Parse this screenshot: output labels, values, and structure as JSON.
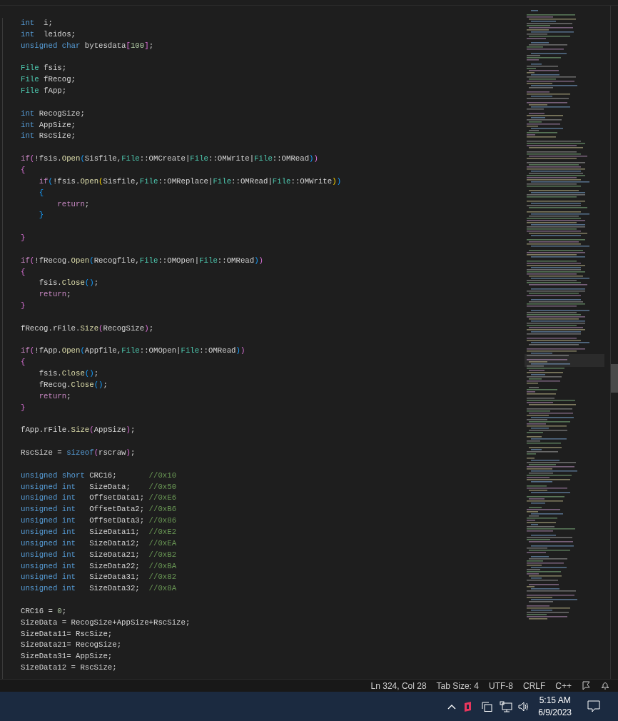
{
  "editor": {
    "lines": [
      {
        "kind": "code",
        "tokens": [
          {
            "kind": "keyword",
            "text": "int"
          },
          {
            "kind": "plain",
            "text": "  i;"
          }
        ]
      },
      {
        "kind": "code",
        "tokens": [
          {
            "kind": "keyword",
            "text": "int"
          },
          {
            "kind": "plain",
            "text": "  leidos;"
          }
        ]
      },
      {
        "kind": "code",
        "tokens": [
          {
            "kind": "keyword",
            "text": "unsigned char"
          },
          {
            "kind": "plain",
            "text": " bytesdata"
          },
          {
            "kind": "bracket2",
            "text": "["
          },
          {
            "kind": "number",
            "text": "100"
          },
          {
            "kind": "bracket2",
            "text": "]"
          },
          {
            "kind": "plain",
            "text": ";"
          }
        ]
      },
      {
        "kind": "blank"
      },
      {
        "kind": "code",
        "tokens": [
          {
            "kind": "type",
            "text": "File"
          },
          {
            "kind": "plain",
            "text": " fsis;"
          }
        ]
      },
      {
        "kind": "code",
        "tokens": [
          {
            "kind": "type",
            "text": "File"
          },
          {
            "kind": "plain",
            "text": " fRecog;"
          }
        ]
      },
      {
        "kind": "code",
        "tokens": [
          {
            "kind": "type",
            "text": "File"
          },
          {
            "kind": "plain",
            "text": " fApp;"
          }
        ]
      },
      {
        "kind": "blank"
      },
      {
        "kind": "code",
        "tokens": [
          {
            "kind": "keyword",
            "text": "int"
          },
          {
            "kind": "plain",
            "text": " RecogSize;"
          }
        ]
      },
      {
        "kind": "code",
        "tokens": [
          {
            "kind": "keyword",
            "text": "int"
          },
          {
            "kind": "plain",
            "text": " AppSize;"
          }
        ]
      },
      {
        "kind": "code",
        "tokens": [
          {
            "kind": "keyword",
            "text": "int"
          },
          {
            "kind": "plain",
            "text": " RscSize;"
          }
        ]
      },
      {
        "kind": "blank"
      },
      {
        "kind": "code",
        "tokens": [
          {
            "kind": "control",
            "text": "if"
          },
          {
            "kind": "bracket2",
            "text": "("
          },
          {
            "kind": "plain",
            "text": "!fsis."
          },
          {
            "kind": "function",
            "text": "Open"
          },
          {
            "kind": "bracket3",
            "text": "("
          },
          {
            "kind": "plain",
            "text": "Sisfile,"
          },
          {
            "kind": "type",
            "text": "File"
          },
          {
            "kind": "plain",
            "text": "::OMCreate|"
          },
          {
            "kind": "type",
            "text": "File"
          },
          {
            "kind": "plain",
            "text": "::OMWrite|"
          },
          {
            "kind": "type",
            "text": "File"
          },
          {
            "kind": "plain",
            "text": "::OMRead"
          },
          {
            "kind": "bracket3",
            "text": ")"
          },
          {
            "kind": "bracket2",
            "text": ")"
          }
        ]
      },
      {
        "kind": "code",
        "tokens": [
          {
            "kind": "bracket2",
            "text": "{"
          }
        ]
      },
      {
        "kind": "code",
        "tokens": [
          {
            "kind": "indent"
          },
          {
            "kind": "control",
            "text": "if"
          },
          {
            "kind": "bracket3",
            "text": "("
          },
          {
            "kind": "plain",
            "text": "!fsis."
          },
          {
            "kind": "function",
            "text": "Open"
          },
          {
            "kind": "bracket1",
            "text": "("
          },
          {
            "kind": "plain",
            "text": "Sisfile,"
          },
          {
            "kind": "type",
            "text": "File"
          },
          {
            "kind": "plain",
            "text": "::OMReplace|"
          },
          {
            "kind": "type",
            "text": "File"
          },
          {
            "kind": "plain",
            "text": "::OMRead|"
          },
          {
            "kind": "type",
            "text": "File"
          },
          {
            "kind": "plain",
            "text": "::OMWrite"
          },
          {
            "kind": "bracket1",
            "text": ")"
          },
          {
            "kind": "bracket3",
            "text": ")"
          }
        ]
      },
      {
        "kind": "code",
        "tokens": [
          {
            "kind": "indent"
          },
          {
            "kind": "bracket3",
            "text": "{"
          }
        ]
      },
      {
        "kind": "code",
        "tokens": [
          {
            "kind": "indent"
          },
          {
            "kind": "indent"
          },
          {
            "kind": "control",
            "text": "return"
          },
          {
            "kind": "plain",
            "text": ";"
          }
        ]
      },
      {
        "kind": "code",
        "tokens": [
          {
            "kind": "indent"
          },
          {
            "kind": "bracket3",
            "text": "}"
          }
        ]
      },
      {
        "kind": "blank"
      },
      {
        "kind": "code",
        "tokens": [
          {
            "kind": "bracket2",
            "text": "}"
          }
        ]
      },
      {
        "kind": "blank"
      },
      {
        "kind": "code",
        "tokens": [
          {
            "kind": "control",
            "text": "if"
          },
          {
            "kind": "bracket2",
            "text": "("
          },
          {
            "kind": "plain",
            "text": "!fRecog."
          },
          {
            "kind": "function",
            "text": "Open"
          },
          {
            "kind": "bracket3",
            "text": "("
          },
          {
            "kind": "plain",
            "text": "Recogfile,"
          },
          {
            "kind": "type",
            "text": "File"
          },
          {
            "kind": "plain",
            "text": "::OMOpen|"
          },
          {
            "kind": "type",
            "text": "File"
          },
          {
            "kind": "plain",
            "text": "::OMRead"
          },
          {
            "kind": "bracket3",
            "text": ")"
          },
          {
            "kind": "bracket2",
            "text": ")"
          }
        ]
      },
      {
        "kind": "code",
        "tokens": [
          {
            "kind": "bracket2",
            "text": "{"
          }
        ]
      },
      {
        "kind": "code",
        "tokens": [
          {
            "kind": "indent"
          },
          {
            "kind": "plain",
            "text": "fsis."
          },
          {
            "kind": "function",
            "text": "Close"
          },
          {
            "kind": "bracket3",
            "text": "()"
          },
          {
            "kind": "plain",
            "text": ";"
          }
        ]
      },
      {
        "kind": "code",
        "tokens": [
          {
            "kind": "indent"
          },
          {
            "kind": "control",
            "text": "return"
          },
          {
            "kind": "plain",
            "text": ";"
          }
        ]
      },
      {
        "kind": "code",
        "tokens": [
          {
            "kind": "bracket2",
            "text": "}"
          }
        ]
      },
      {
        "kind": "blank"
      },
      {
        "kind": "code",
        "tokens": [
          {
            "kind": "plain",
            "text": "fRecog.rFile."
          },
          {
            "kind": "function",
            "text": "Size"
          },
          {
            "kind": "bracket2",
            "text": "("
          },
          {
            "kind": "plain",
            "text": "RecogSize"
          },
          {
            "kind": "bracket2",
            "text": ")"
          },
          {
            "kind": "plain",
            "text": ";"
          }
        ]
      },
      {
        "kind": "blank"
      },
      {
        "kind": "code",
        "tokens": [
          {
            "kind": "control",
            "text": "if"
          },
          {
            "kind": "bracket2",
            "text": "("
          },
          {
            "kind": "plain",
            "text": "!fApp."
          },
          {
            "kind": "function",
            "text": "Open"
          },
          {
            "kind": "bracket3",
            "text": "("
          },
          {
            "kind": "plain",
            "text": "Appfile,"
          },
          {
            "kind": "type",
            "text": "File"
          },
          {
            "kind": "plain",
            "text": "::OMOpen|"
          },
          {
            "kind": "type",
            "text": "File"
          },
          {
            "kind": "plain",
            "text": "::OMRead"
          },
          {
            "kind": "bracket3",
            "text": ")"
          },
          {
            "kind": "bracket2",
            "text": ")"
          }
        ]
      },
      {
        "kind": "code",
        "tokens": [
          {
            "kind": "bracket2",
            "text": "{"
          }
        ]
      },
      {
        "kind": "code",
        "tokens": [
          {
            "kind": "indent"
          },
          {
            "kind": "plain",
            "text": "fsis."
          },
          {
            "kind": "function",
            "text": "Close"
          },
          {
            "kind": "bracket3",
            "text": "()"
          },
          {
            "kind": "plain",
            "text": ";"
          }
        ]
      },
      {
        "kind": "code",
        "tokens": [
          {
            "kind": "indent"
          },
          {
            "kind": "plain",
            "text": "fRecog."
          },
          {
            "kind": "function",
            "text": "Close"
          },
          {
            "kind": "bracket3",
            "text": "()"
          },
          {
            "kind": "plain",
            "text": ";"
          }
        ]
      },
      {
        "kind": "code",
        "tokens": [
          {
            "kind": "indent"
          },
          {
            "kind": "control",
            "text": "return"
          },
          {
            "kind": "plain",
            "text": ";"
          }
        ]
      },
      {
        "kind": "code",
        "tokens": [
          {
            "kind": "bracket2",
            "text": "}"
          }
        ]
      },
      {
        "kind": "blank"
      },
      {
        "kind": "code",
        "tokens": [
          {
            "kind": "plain",
            "text": "fApp.rFile."
          },
          {
            "kind": "function",
            "text": "Size"
          },
          {
            "kind": "bracket2",
            "text": "("
          },
          {
            "kind": "plain",
            "text": "AppSize"
          },
          {
            "kind": "bracket2",
            "text": ")"
          },
          {
            "kind": "plain",
            "text": ";"
          }
        ]
      },
      {
        "kind": "blank"
      },
      {
        "kind": "code",
        "tokens": [
          {
            "kind": "plain",
            "text": "RscSize = "
          },
          {
            "kind": "keyword",
            "text": "sizeof"
          },
          {
            "kind": "bracket2",
            "text": "("
          },
          {
            "kind": "plain",
            "text": "rscraw"
          },
          {
            "kind": "bracket2",
            "text": ")"
          },
          {
            "kind": "plain",
            "text": ";"
          }
        ]
      },
      {
        "kind": "blank"
      },
      {
        "kind": "code",
        "tokens": [
          {
            "kind": "keyword",
            "text": "unsigned short"
          },
          {
            "kind": "plain",
            "text": " CRC16;       "
          },
          {
            "kind": "comment",
            "text": "//0x10"
          }
        ]
      },
      {
        "kind": "code",
        "tokens": [
          {
            "kind": "keyword",
            "text": "unsigned int"
          },
          {
            "kind": "plain",
            "text": "   SizeData;    "
          },
          {
            "kind": "comment",
            "text": "//0x50"
          }
        ]
      },
      {
        "kind": "code",
        "tokens": [
          {
            "kind": "keyword",
            "text": "unsigned int"
          },
          {
            "kind": "plain",
            "text": "   OffsetData1; "
          },
          {
            "kind": "comment",
            "text": "//0xE6"
          }
        ]
      },
      {
        "kind": "code",
        "tokens": [
          {
            "kind": "keyword",
            "text": "unsigned int"
          },
          {
            "kind": "plain",
            "text": "   OffsetData2; "
          },
          {
            "kind": "comment",
            "text": "//0xB6"
          }
        ]
      },
      {
        "kind": "code",
        "tokens": [
          {
            "kind": "keyword",
            "text": "unsigned int"
          },
          {
            "kind": "plain",
            "text": "   OffsetData3; "
          },
          {
            "kind": "comment",
            "text": "//0x86"
          }
        ]
      },
      {
        "kind": "code",
        "tokens": [
          {
            "kind": "keyword",
            "text": "unsigned int"
          },
          {
            "kind": "plain",
            "text": "   SizeData11;  "
          },
          {
            "kind": "comment",
            "text": "//0xE2"
          }
        ]
      },
      {
        "kind": "code",
        "tokens": [
          {
            "kind": "keyword",
            "text": "unsigned int"
          },
          {
            "kind": "plain",
            "text": "   SizeData12;  "
          },
          {
            "kind": "comment",
            "text": "//0xEA"
          }
        ]
      },
      {
        "kind": "code",
        "tokens": [
          {
            "kind": "keyword",
            "text": "unsigned int"
          },
          {
            "kind": "plain",
            "text": "   SizeData21;  "
          },
          {
            "kind": "comment",
            "text": "//0xB2"
          }
        ]
      },
      {
        "kind": "code",
        "tokens": [
          {
            "kind": "keyword",
            "text": "unsigned int"
          },
          {
            "kind": "plain",
            "text": "   SizeData22;  "
          },
          {
            "kind": "comment",
            "text": "//0xBA"
          }
        ]
      },
      {
        "kind": "code",
        "tokens": [
          {
            "kind": "keyword",
            "text": "unsigned int"
          },
          {
            "kind": "plain",
            "text": "   SizeData31;  "
          },
          {
            "kind": "comment",
            "text": "//0x82"
          }
        ]
      },
      {
        "kind": "code",
        "tokens": [
          {
            "kind": "keyword",
            "text": "unsigned int"
          },
          {
            "kind": "plain",
            "text": "   SizeData32;  "
          },
          {
            "kind": "comment",
            "text": "//0x8A"
          }
        ]
      },
      {
        "kind": "blank"
      },
      {
        "kind": "code",
        "tokens": [
          {
            "kind": "plain",
            "text": "CRC16 = "
          },
          {
            "kind": "number",
            "text": "0"
          },
          {
            "kind": "plain",
            "text": ";"
          }
        ]
      },
      {
        "kind": "code",
        "tokens": [
          {
            "kind": "plain",
            "text": "SizeData = RecogSize+AppSize+RscSize;"
          }
        ]
      },
      {
        "kind": "code",
        "tokens": [
          {
            "kind": "plain",
            "text": "SizeData11= RscSize;"
          }
        ]
      },
      {
        "kind": "code",
        "tokens": [
          {
            "kind": "plain",
            "text": "SizeData21= RecogSize;"
          }
        ]
      },
      {
        "kind": "code",
        "tokens": [
          {
            "kind": "plain",
            "text": "SizeData31= AppSize;"
          }
        ]
      },
      {
        "kind": "code",
        "tokens": [
          {
            "kind": "plain",
            "text": "SizeData12 = RscSize;"
          }
        ]
      }
    ]
  },
  "status_bar": {
    "items": [
      "Ln 324, Col 28",
      "Tab Size: 4",
      "UTF-8",
      "CRLF",
      "C++"
    ]
  },
  "taskbar": {
    "time": "5:15 AM",
    "date": "6/9/2023"
  }
}
